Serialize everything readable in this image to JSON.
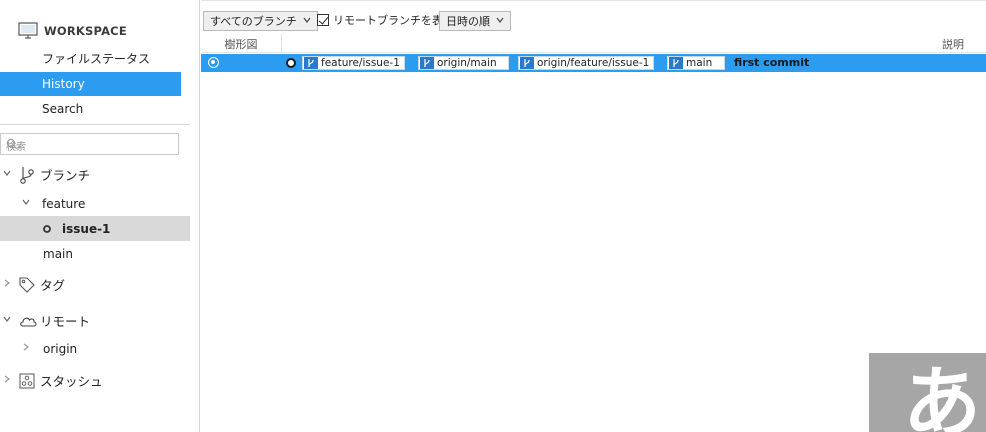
{
  "sidebar": {
    "workspace_label": "WORKSPACE",
    "nav": [
      {
        "label": "ファイルステータス"
      },
      {
        "label": "History",
        "active": true
      },
      {
        "label": "Search"
      }
    ],
    "search_placeholder": "検索",
    "sections": {
      "branches": "ブランチ",
      "feature": "feature",
      "issue1": "issue-1",
      "main": "main",
      "tags": "タグ",
      "remotes": "リモート",
      "origin": "origin",
      "stash": "スタッシュ"
    }
  },
  "toolbar": {
    "branch_filter": "すべてのブランチ",
    "show_remote_label": "リモートブランチを表示",
    "show_remote_checked": true,
    "sort_order": "日時の順"
  },
  "columns": {
    "graph": "樹形図",
    "description": "説明"
  },
  "commit": {
    "refs": [
      "feature/issue-1",
      "origin/main",
      "origin/feature/issue-1",
      "main"
    ],
    "message": "first commit"
  },
  "ime": {
    "char": "あ"
  },
  "colors": {
    "accent": "#2b9cf0",
    "branch_icon": "#2b7ac9"
  }
}
